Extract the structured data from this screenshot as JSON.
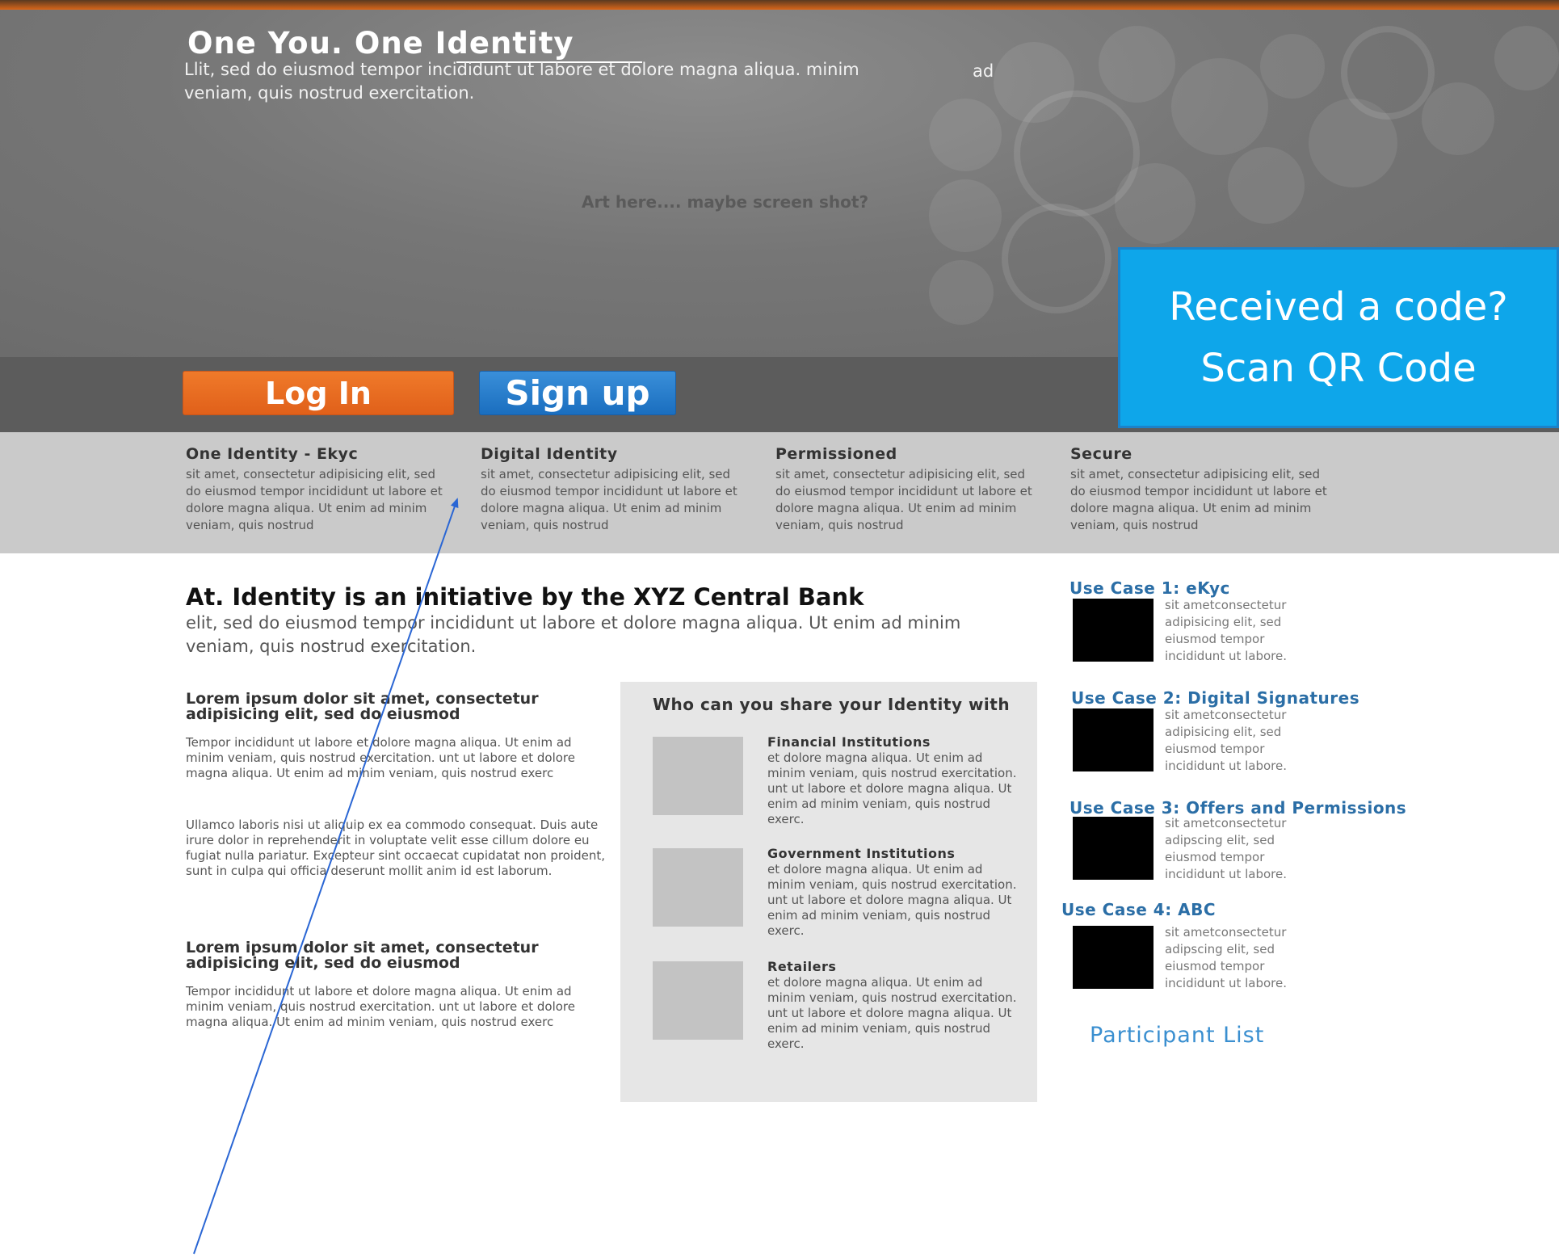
{
  "hero": {
    "title": "One You. One Identity",
    "text": "Llit, sed do eiusmod tempor incididunt ut labore et dolore magna aliqua. minim veniam, quis nostrud exercitation.",
    "ad": "ad",
    "art_placeholder": "Art here.... maybe screen shot?"
  },
  "actions": {
    "login_label": "Log In",
    "signup_label": "Sign up",
    "qr_line1": "Received a code?",
    "qr_line2": "Scan QR Code"
  },
  "features": [
    {
      "title": "One Identity - Ekyc",
      "text": "sit amet, consectetur adipisicing elit, sed do eiusmod tempor incididunt ut labore et dolore magna aliqua. Ut enim ad minim veniam, quis nostrud"
    },
    {
      "title": "Digital Identity",
      "text": "sit amet, consectetur adipisicing elit, sed do eiusmod tempor incididunt ut labore et dolore magna aliqua. Ut enim ad minim veniam, quis nostrud"
    },
    {
      "title": "Permissioned",
      "text": "sit amet, consectetur adipisicing elit, sed do eiusmod tempor incididunt ut labore et dolore magna aliqua. Ut enim ad minim veniam, quis nostrud"
    },
    {
      "title": "Secure",
      "text": "sit amet, consectetur adipisicing elit, sed do eiusmod tempor incididunt ut labore et dolore magna aliqua. Ut enim ad minim veniam, quis nostrud"
    }
  ],
  "intro": {
    "title": "At. Identity is an initiative by the XYZ Central Bank",
    "text": "elit, sed do eiusmod tempor incididunt ut labore et dolore magna aliqua. Ut enim ad minim veniam, quis nostrud exercitation."
  },
  "lorem": [
    {
      "heading": "Lorem ipsum dolor sit amet, consectetur adipisicing elit, sed do eiusmod",
      "p1": "Tempor incididunt ut labore et dolore magna aliqua. Ut enim ad minim veniam, quis nostrud exercitation. unt ut labore et dolore magna aliqua. Ut enim ad minim veniam, quis nostrud exerc",
      "p2": "Ullamco laboris nisi ut aliquip ex ea commodo consequat. Duis aute irure dolor in reprehenderit in voluptate velit esse cillum dolore eu fugiat nulla pariatur. Excepteur sint occaecat cupidatat non proident, sunt in culpa qui officia deserunt mollit anim id est laborum."
    },
    {
      "heading": "Lorem ipsum dolor sit amet, consectetur adipisicing elit, sed do eiusmod",
      "p1": "Tempor incididunt ut labore et dolore magna aliqua. Ut enim ad minim veniam, quis nostrud exercitation. unt ut labore et dolore magna aliqua. Ut enim ad minim veniam, quis nostrud exerc"
    }
  ],
  "share": {
    "title": "Who can you share your Identity with",
    "items": [
      {
        "name": "Financial Institutions",
        "text": "et dolore magna aliqua. Ut enim ad minim veniam, quis nostrud exercitation. unt ut labore et dolore magna aliqua. Ut enim ad minim veniam, quis nostrud exerc."
      },
      {
        "name": "Government Institutions",
        "text": "et dolore magna aliqua. Ut enim ad minim veniam, quis nostrud exercitation. unt ut labore et dolore magna aliqua. Ut enim ad minim veniam, quis nostrud exerc."
      },
      {
        "name": "Retailers",
        "text": "et dolore magna aliqua. Ut enim ad minim veniam, quis nostrud exercitation. unt ut labore et dolore magna aliqua. Ut enim ad minim veniam, quis nostrud exerc."
      }
    ]
  },
  "use_cases": [
    {
      "title": "Use Case 1: eKyc",
      "text": "sit ametconsectetur adipisicing elit, sed eiusmod tempor incididunt ut labore."
    },
    {
      "title": "Use Case 2: Digital Signatures",
      "text": "sit ametconsectetur adipisicing elit, sed eiusmod tempor incididunt ut labore."
    },
    {
      "title": "Use Case 3: Offers and Permissions",
      "text": "sit ametconsectetur adipscing elit, sed eiusmod tempor incididunt ut labore."
    },
    {
      "title": "Use Case 4: ABC",
      "text": "sit ametconsectetur adipscing elit, sed eiusmod tempor incididunt ut labore."
    }
  ],
  "participant_link": "Participant List",
  "colors": {
    "orange_button": "#e8681e",
    "blue_button": "#2a7fcf",
    "qr_box": "#0ea6ea",
    "link_blue": "#2b6ea6",
    "annotation_line": "#2a66d4"
  }
}
